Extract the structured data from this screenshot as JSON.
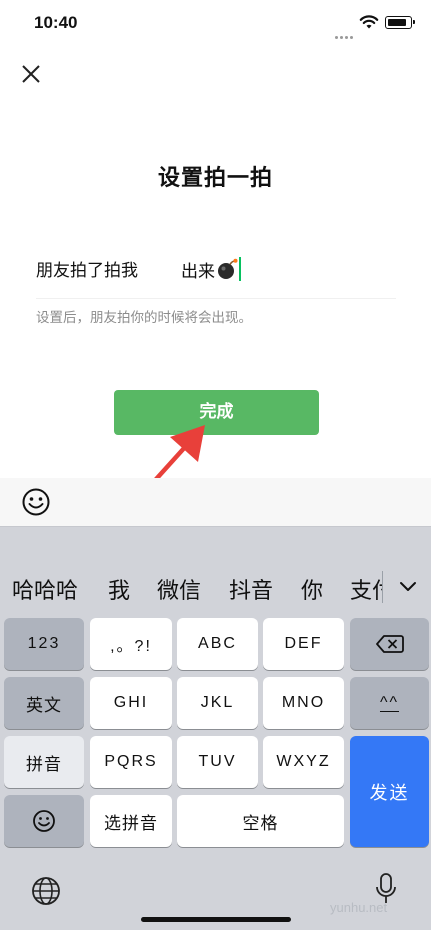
{
  "status_bar": {
    "time": "10:40"
  },
  "page": {
    "title": "设置拍一拍",
    "pat_prefix": "朋友拍了拍我",
    "pat_suffix_value": "出来",
    "hint": "设置后，朋友拍你的时候将会出现。",
    "done_label": "完成"
  },
  "emoji_bar": {
    "icon": "smile-icon"
  },
  "keyboard": {
    "candidates": [
      "哈哈哈",
      "我",
      "微信",
      "抖音",
      "你",
      "支付"
    ],
    "keys": {
      "num": "123",
      "punct": ",。?!",
      "abc": "ABC",
      "def": "DEF",
      "english": "英文",
      "ghi": "GHI",
      "jkl": "JKL",
      "mno": "MNO",
      "face": "^^",
      "pinyin": "拼音",
      "pqrs": "PQRS",
      "tuv": "TUV",
      "wxyz": "WXYZ",
      "send": "发送",
      "select_pinyin": "选拼音",
      "space": "空格"
    }
  },
  "watermark": "yunhu.net",
  "colors": {
    "accent_green": "#58b864",
    "send_blue": "#3478f6",
    "arrow_red": "#e8403a"
  }
}
